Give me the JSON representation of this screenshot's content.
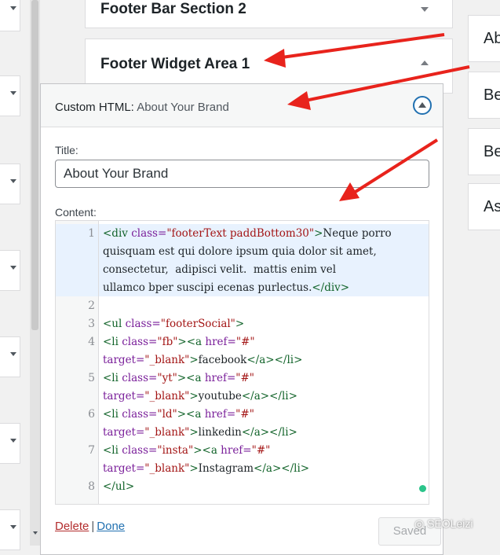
{
  "widget_areas": {
    "footer_bar_section_2": "Footer Bar Section 2",
    "footer_widget_area_1": "Footer Widget Area 1"
  },
  "widget": {
    "title_prefix": "Custom HTML:",
    "title_name": "About Your Brand",
    "title_label": "Title:",
    "title_value": "About Your Brand",
    "content_label": "Content:",
    "line_numbers": [
      "1",
      "2",
      "3",
      "4",
      "5",
      "6",
      "7",
      "8"
    ],
    "code": {
      "l1a_tag_open": "<div ",
      "l1a_attr": "class=",
      "l1a_str": "\"footerText paddBottom30\"",
      "l1a_tag_close": ">",
      "l1a_text": "Neque porro",
      "l1b": "quisquam est qui dolore ipsum quia dolor sit amet,",
      "l1c": "consectetur,  adipisci velit.  mattis enim vel",
      "l1d_text": "ullamco bper suscipi ecenas purlectus.",
      "l1d_tag": "</div>",
      "l3_tag": "<ul ",
      "l3_attr": "class=",
      "l3_str": "\"footerSocial\"",
      "l3_close": ">",
      "l4_tag": "<li ",
      "l4_attr": "class=",
      "l4_str": "\"fb\"",
      "l4_a": "><a ",
      "l4_href": "href=",
      "l4_hstr": "\"#\"",
      "l4b_attr": "target=",
      "l4b_str": "\"_blank\"",
      "l4b_close": ">",
      "l4b_text": "facebook",
      "l4b_end": "</a></li>",
      "l5_str": "\"yt\"",
      "l5b_text": "youtube",
      "l6_str": "\"ld\"",
      "l6b_text": "linkedin",
      "l7_str": "\"insta\"",
      "l7b_text": "Instagram",
      "l8": "</ul>"
    },
    "delete_label": "Delete",
    "separator": "|",
    "done_label": "Done",
    "saved_label": "Saved"
  },
  "right_items": [
    "Ab",
    "Be",
    "Be",
    "As"
  ],
  "watermark": "SEOLeizi",
  "colors": {
    "accent": "#2271b1",
    "delete": "#b32d2e",
    "annotation_arrow": "#e8231c"
  }
}
